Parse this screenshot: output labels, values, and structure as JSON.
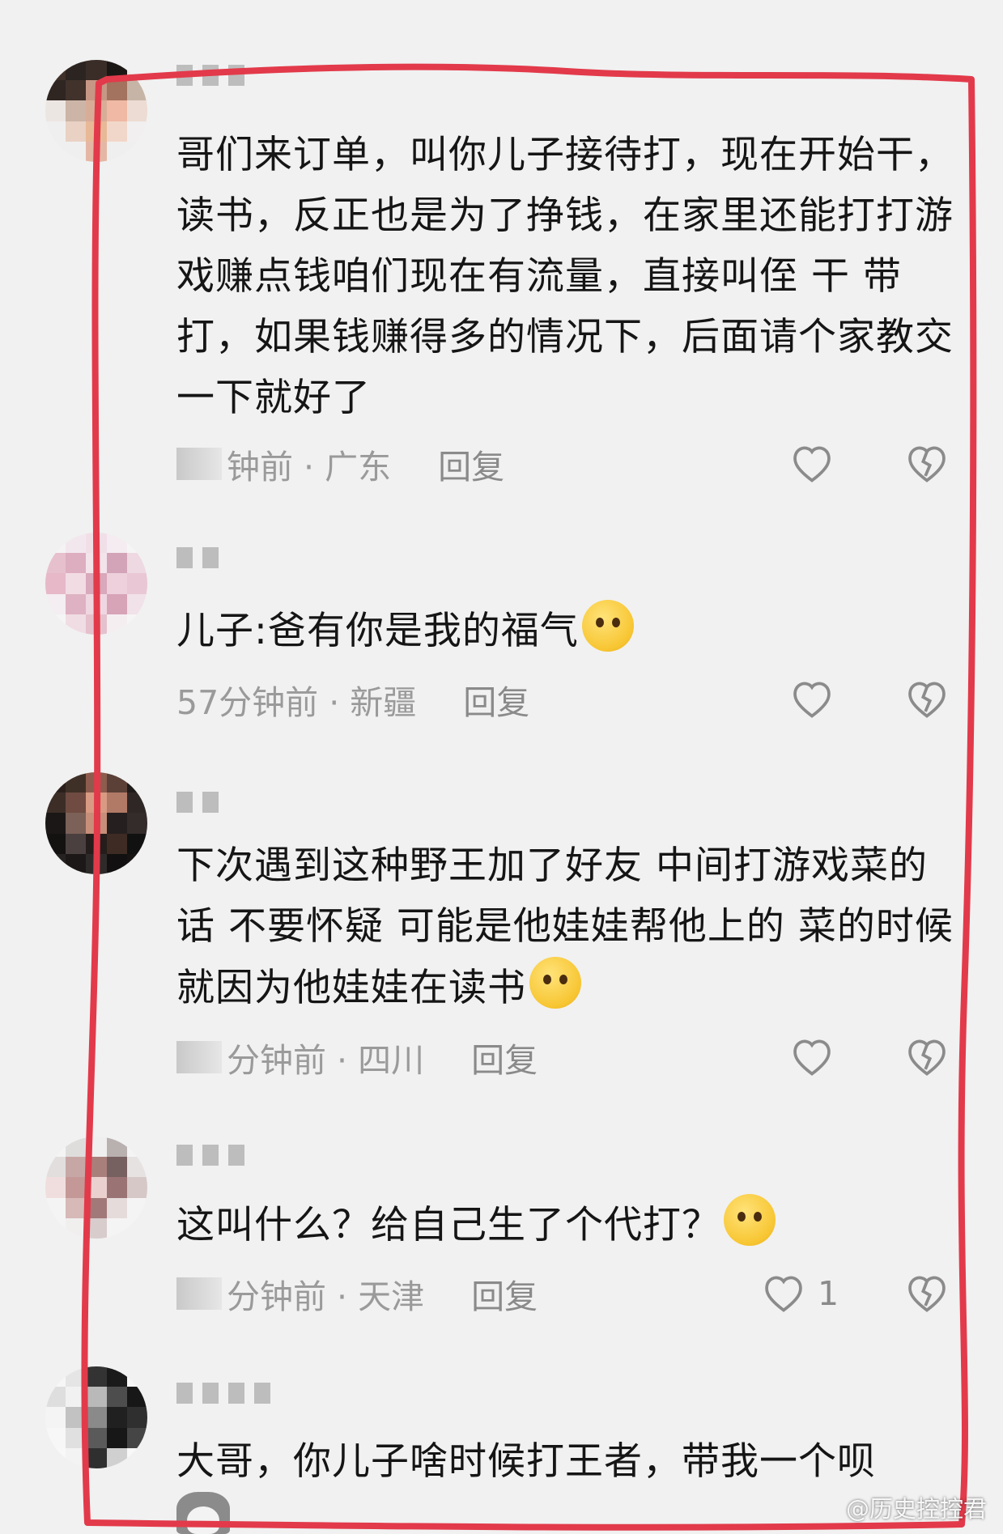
{
  "comments": [
    {
      "text": "哥们来订单，叫你儿子接待打，现在开始干，读书，反正也是为了挣钱，在家里还能打打游戏赚点钱咱们现在有流量，直接叫侄 干 带打，如果钱赚得多的情况下，后面请个家教交一下就好了",
      "meta": "钟前 · 广东",
      "reply": "回复",
      "likes": ""
    },
    {
      "text": "儿子:爸有你是我的福气",
      "meta": "57分钟前 · 新疆",
      "reply": "回复",
      "likes": ""
    },
    {
      "text": "下次遇到这种野王加了好友 中间打游戏菜的话 不要怀疑 可能是他娃娃帮他上的 菜的时候就因为他娃娃在读书",
      "meta": "分钟前 · 四川",
      "reply": "回复",
      "likes": ""
    },
    {
      "text": "这叫什么？给自己生了个代打？",
      "meta": "分钟前 · 天津",
      "reply": "回复",
      "likes": "1"
    },
    {
      "text": "大哥，你儿子啥时候打王者，带我一个呗",
      "meta": "",
      "reply": "",
      "likes": ""
    }
  ],
  "watermark": "@历史控控君",
  "colors": {
    "highlight": "#e23a4a",
    "background": "#f1f1f1",
    "meta": "#9a9a9a"
  },
  "icons": {
    "like": "heart-outline-icon",
    "dislike": "broken-heart-icon",
    "emoji": "emoji-icon",
    "dog": "dog-sticker-icon"
  }
}
